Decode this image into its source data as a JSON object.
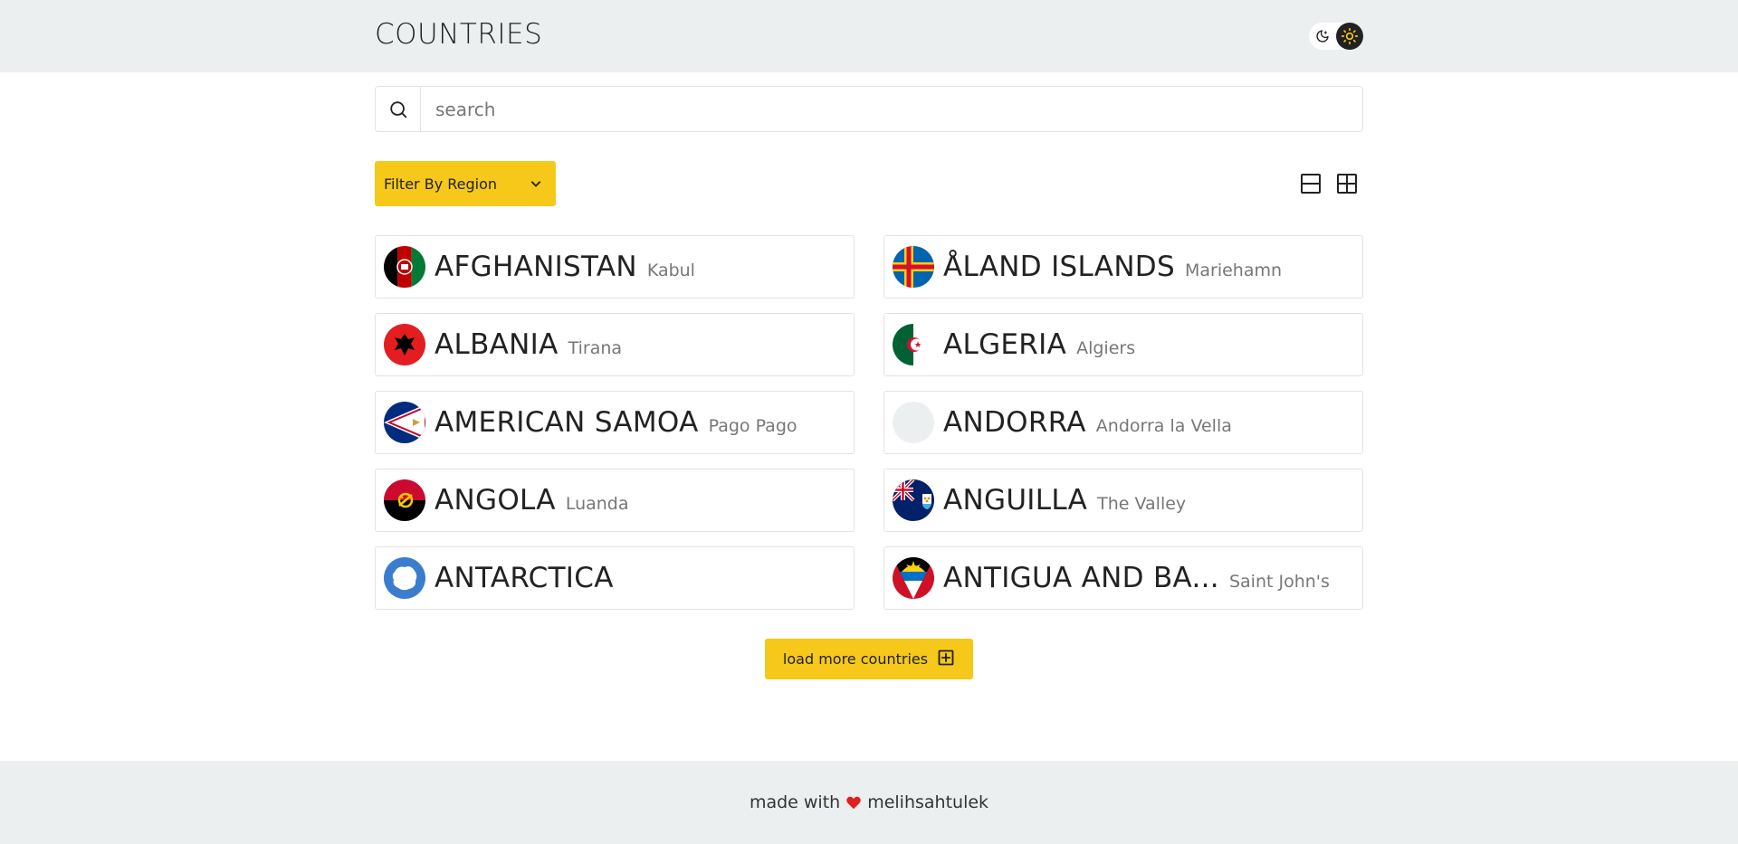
{
  "header": {
    "title": "COUNTRIES"
  },
  "search": {
    "placeholder": "search",
    "value": ""
  },
  "filter": {
    "label": "Filter By Region"
  },
  "countries": [
    {
      "name": "AFGHANISTAN",
      "capital": "Kabul",
      "flag": "afghanistan-flag"
    },
    {
      "name": "ÅLAND ISLANDS",
      "capital": "Mariehamn",
      "flag": "aland-flag"
    },
    {
      "name": "ALBANIA",
      "capital": "Tirana",
      "flag": "albania-flag"
    },
    {
      "name": "ALGERIA",
      "capital": "Algiers",
      "flag": "algeria-flag"
    },
    {
      "name": "AMERICAN SAMOA",
      "capital": "Pago Pago",
      "flag": "american-samoa-flag"
    },
    {
      "name": "ANDORRA",
      "capital": "Andorra la Vella",
      "flag": "placeholder-flag"
    },
    {
      "name": "ANGOLA",
      "capital": "Luanda",
      "flag": "angola-flag"
    },
    {
      "name": "ANGUILLA",
      "capital": "The Valley",
      "flag": "anguilla-flag"
    },
    {
      "name": "ANTARCTICA",
      "capital": "",
      "flag": "antarctica-flag"
    },
    {
      "name": "ANTIGUA AND BA...",
      "capital": "Saint John's",
      "flag": "antigua-flag"
    }
  ],
  "load_more": {
    "label": "load more countries"
  },
  "footer": {
    "prefix": "made with",
    "author": "melihsahtulek"
  },
  "colors": {
    "accent": "#f6c81a",
    "header_bg": "#eceff0",
    "heart": "#e0201f"
  }
}
